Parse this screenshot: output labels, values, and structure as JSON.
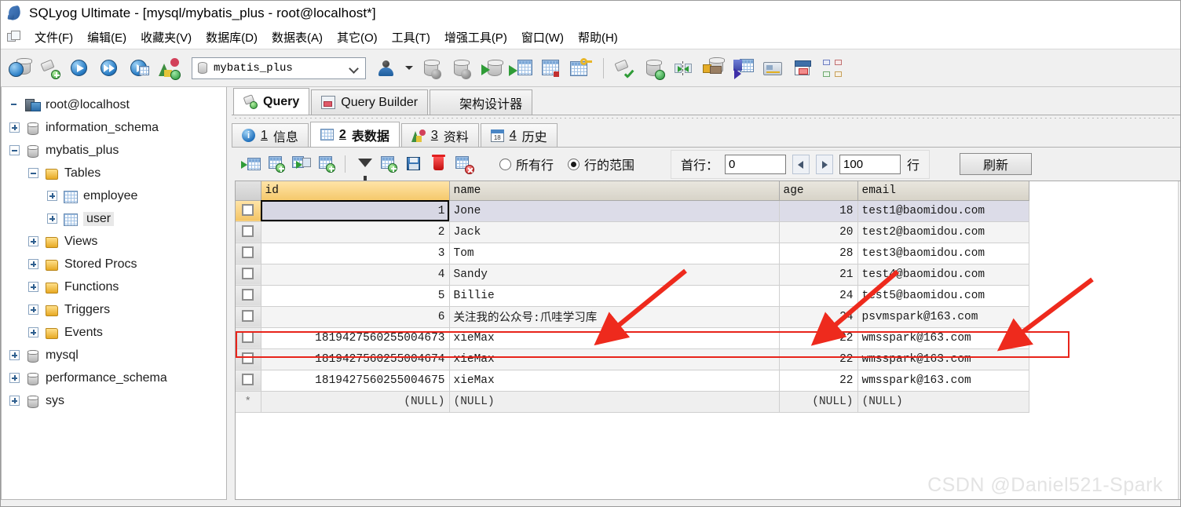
{
  "window": {
    "title": "SQLyog Ultimate - [mysql/mybatis_plus - root@localhost*]",
    "app_icon": "dolphin-icon"
  },
  "menu": {
    "items": [
      {
        "label": "文件(F)",
        "mnemonic": "F"
      },
      {
        "label": "编辑(E)",
        "mnemonic": "E"
      },
      {
        "label": "收藏夹(V)",
        "mnemonic": "V"
      },
      {
        "label": "数据库(D)",
        "mnemonic": "D"
      },
      {
        "label": "数据表(A)",
        "mnemonic": "A"
      },
      {
        "label": "其它(O)",
        "mnemonic": "O"
      },
      {
        "label": "工具(T)",
        "mnemonic": "T"
      },
      {
        "label": "增强工具(P)",
        "mnemonic": "P"
      },
      {
        "label": "窗口(W)",
        "mnemonic": "W"
      },
      {
        "label": "帮助(H)",
        "mnemonic": "H"
      }
    ]
  },
  "toolbar": {
    "database_selector": {
      "value": "mybatis_plus",
      "icon": "database-icon"
    },
    "icons": [
      "connection-manager-icon",
      "new-connection-icon",
      "execute-query-icon",
      "execute-all-queries-icon",
      "execute-query-new-tab-icon",
      "refresh-object-browser-icon",
      "user-manager-icon",
      "import-database-icon",
      "export-database-icon",
      "restore-backup-icon",
      "import-table-icon",
      "export-table-csv-icon",
      "manage-indexes-icon",
      "copy-database-icon",
      "sync-database-icon",
      "compare-schema-icon",
      "scheduled-backup-icon",
      "migration-icon",
      "notification-services-icon",
      "table-diagnostics-icon",
      "schema-designer-icon"
    ]
  },
  "sidebar": {
    "root": {
      "label": "root@localhost",
      "icon": "server-icon"
    },
    "items": [
      {
        "label": "information_schema",
        "icon": "database-icon",
        "toggle": "plus",
        "indent": 1
      },
      {
        "label": "mybatis_plus",
        "icon": "database-icon",
        "toggle": "minus",
        "indent": 1
      },
      {
        "label": "Tables",
        "icon": "folder-icon",
        "toggle": "minus",
        "indent": 2
      },
      {
        "label": "employee",
        "icon": "table-icon",
        "toggle": "plus",
        "indent": 3
      },
      {
        "label": "user",
        "icon": "table-icon",
        "toggle": "plus",
        "indent": 3,
        "selected": true
      },
      {
        "label": "Views",
        "icon": "folder-icon",
        "toggle": "plus",
        "indent": 2
      },
      {
        "label": "Stored Procs",
        "icon": "folder-icon",
        "toggle": "plus",
        "indent": 2
      },
      {
        "label": "Functions",
        "icon": "folder-icon",
        "toggle": "plus",
        "indent": 2
      },
      {
        "label": "Triggers",
        "icon": "folder-icon",
        "toggle": "plus",
        "indent": 2
      },
      {
        "label": "Events",
        "icon": "folder-icon",
        "toggle": "plus",
        "indent": 2
      },
      {
        "label": "mysql",
        "icon": "database-icon",
        "toggle": "plus",
        "indent": 1
      },
      {
        "label": "performance_schema",
        "icon": "database-icon",
        "toggle": "plus",
        "indent": 1
      },
      {
        "label": "sys",
        "icon": "database-icon",
        "toggle": "plus",
        "indent": 1
      }
    ]
  },
  "outer_tabs": [
    {
      "label": "Query",
      "icon": "query-icon",
      "active": true
    },
    {
      "label": "Query Builder",
      "icon": "query-builder-icon",
      "active": false
    },
    {
      "label": "架构设计器",
      "icon": "schema-designer-icon",
      "active": false
    }
  ],
  "inner_tabs": [
    {
      "num": "1",
      "label": "信息",
      "icon": "info-icon",
      "active": false
    },
    {
      "num": "2",
      "label": "表数据",
      "icon": "table-data-icon",
      "active": true
    },
    {
      "num": "3",
      "label": "资料",
      "icon": "chart-icon",
      "active": false
    },
    {
      "num": "4",
      "label": "历史",
      "icon": "calendar-icon",
      "active": false
    }
  ],
  "grid_toolbar": {
    "icons": [
      "insert-row-icon",
      "duplicate-row-icon",
      "insert-blob-icon",
      "clone-row-icon",
      "filter-icon",
      "copy-row-icon",
      "save-changes-icon",
      "delete-row-icon",
      "cancel-changes-icon"
    ],
    "radio_all_rows": {
      "label": "所有行",
      "checked": false
    },
    "radio_row_range": {
      "label": "行的范围",
      "checked": true
    },
    "first_row_label": "首行：",
    "first_row_value": "0",
    "limit_value": "100",
    "rows_suffix": "行",
    "refresh_label": "刷新",
    "prev_icon": "prev-arrow-icon",
    "next_icon": "next-arrow-icon"
  },
  "grid": {
    "columns": [
      "id",
      "name",
      "age",
      "email"
    ],
    "primary_key_column": "id",
    "rows": [
      {
        "id": "1",
        "name": "Jone",
        "age": "18",
        "email": "test1@baomidou.com"
      },
      {
        "id": "2",
        "name": "Jack",
        "age": "20",
        "email": "test2@baomidou.com"
      },
      {
        "id": "3",
        "name": "Tom",
        "age": "28",
        "email": "test3@baomidou.com"
      },
      {
        "id": "4",
        "name": "Sandy",
        "age": "21",
        "email": "test4@baomidou.com"
      },
      {
        "id": "5",
        "name": "Billie",
        "age": "24",
        "email": "test5@baomidou.com"
      },
      {
        "id": "6",
        "name": "关注我的公众号:爪哇学习库",
        "age": "24",
        "email": "psvmspark@163.com"
      },
      {
        "id": "1819427560255004673",
        "name": "xieMax",
        "age": "22",
        "email": "wmsspark@163.com"
      },
      {
        "id": "1819427560255004674",
        "name": "xieMax",
        "age": "22",
        "email": "wmsspark@163.com"
      },
      {
        "id": "1819427560255004675",
        "name": "xieMax",
        "age": "22",
        "email": "wmsspark@163.com"
      }
    ],
    "null_row": {
      "id": "(NULL)",
      "name": "(NULL)",
      "age": "(NULL)",
      "email": "(NULL)"
    },
    "new_row_marker": "*",
    "highlighted_row_index": 5,
    "focused_cell": {
      "row": 0,
      "column": "id"
    }
  },
  "annotations": {
    "highlight_color": "#e8241b",
    "arrow_color": "#ee2a1d",
    "arrow_count": 3,
    "targets": [
      "name-cell-row6",
      "age-cell-row6",
      "email-cell-row6"
    ]
  },
  "watermark": {
    "text": "CSDN @Daniel521-Spark"
  }
}
